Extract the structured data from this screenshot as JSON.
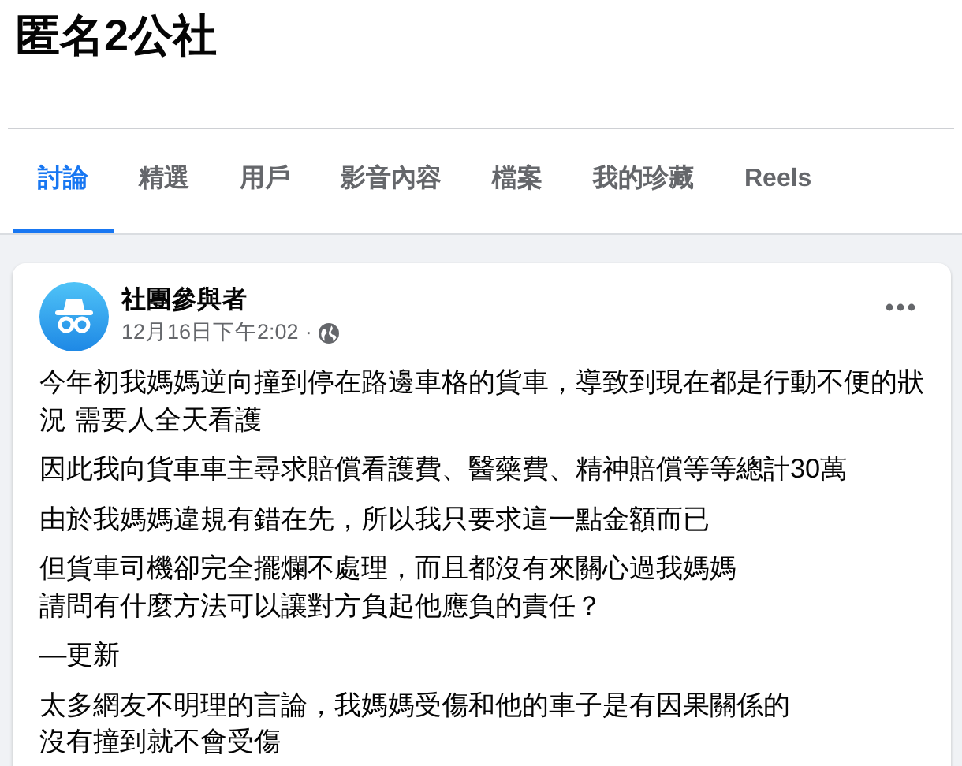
{
  "group": {
    "title": "匿名2公社"
  },
  "tabs": [
    {
      "label": "討論",
      "selected": true
    },
    {
      "label": "精選",
      "selected": false
    },
    {
      "label": "用戶",
      "selected": false
    },
    {
      "label": "影音內容",
      "selected": false
    },
    {
      "label": "檔案",
      "selected": false
    },
    {
      "label": "我的珍藏",
      "selected": false
    },
    {
      "label": "Reels",
      "selected": false
    }
  ],
  "post": {
    "author": "社團參與者",
    "time": "12月16日下午2:02",
    "separator": "·",
    "paragraphs": [
      [
        "今年初我媽媽逆向撞到停在路邊車格的貨車，導致到現在都是行動不便的狀",
        "況 需要人全天看護"
      ],
      [
        "因此我向貨車車主尋求賠償看護費、醫藥費、精神賠償等等總計30萬"
      ],
      [
        "由於我媽媽違規有錯在先，所以我只要求這一點金額而已"
      ],
      [
        "但貨車司機卻完全擺爛不處理，而且都沒有來關心過我媽媽",
        "請問有什麼方法可以讓對方負起他應負的責任？"
      ],
      [
        "—更新"
      ],
      [
        "太多網友不明理的言論，我媽媽受傷和他的車子是有因果關係的",
        "沒有撞到就不會受傷"
      ]
    ]
  }
}
